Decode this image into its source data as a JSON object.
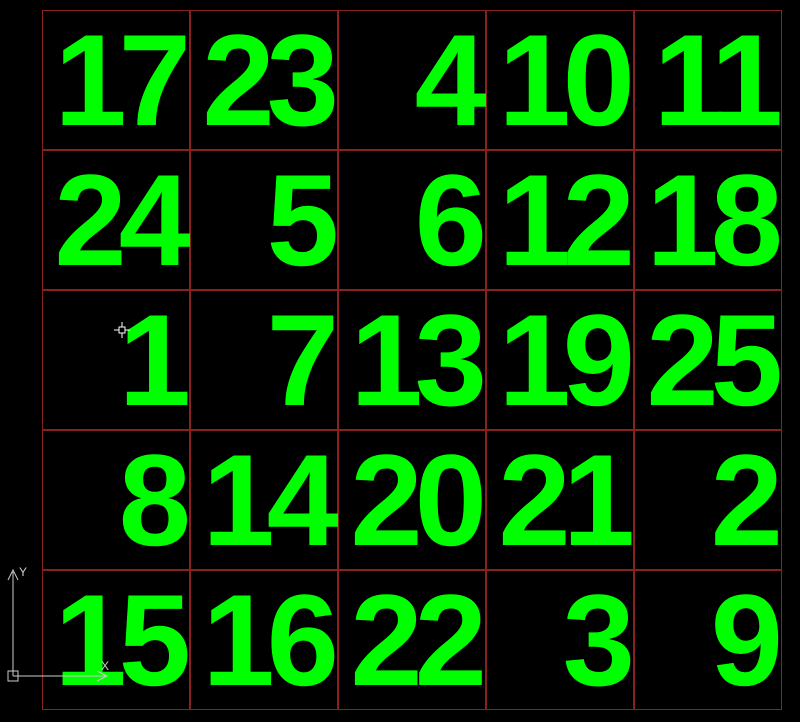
{
  "grid": {
    "rows": [
      [
        "17",
        "23",
        "4",
        "10",
        "11"
      ],
      [
        "24",
        "5",
        "6",
        "12",
        "18"
      ],
      [
        "1",
        "7",
        "13",
        "19",
        "25"
      ],
      [
        "8",
        "14",
        "20",
        "21",
        "2"
      ],
      [
        "15",
        "16",
        "22",
        "3",
        "9"
      ]
    ]
  },
  "ucs": {
    "x_label": "X",
    "y_label": "Y"
  }
}
